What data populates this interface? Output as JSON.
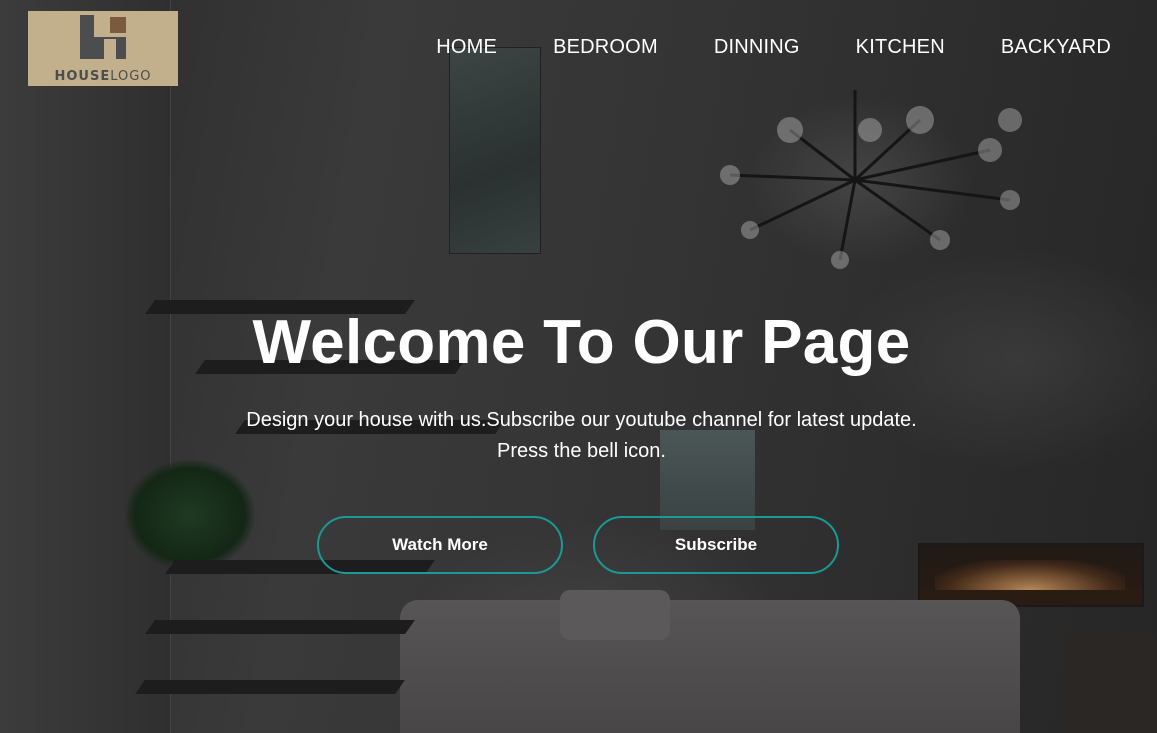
{
  "logo": {
    "text_bold": "HOUSE",
    "text_regular": "LOGO",
    "background_color": "#c2b08d",
    "mark_color": "#4b4d4f",
    "accent_color": "#7a5b3e"
  },
  "nav": {
    "items": [
      {
        "label": "HOME"
      },
      {
        "label": "BEDROOM"
      },
      {
        "label": "DINNING"
      },
      {
        "label": "KITCHEN"
      },
      {
        "label": "BACKYARD"
      }
    ]
  },
  "hero": {
    "title": "Welcome To Our Page",
    "subtitle_line1": "Design your house with us.Subscribe our youtube channel for latest update.",
    "subtitle_line2": "Press the bell icon.",
    "buttons": {
      "watch_more": "Watch More",
      "subscribe": "Subscribe"
    },
    "button_border_color": "#1a9a94",
    "overlay": "dark"
  }
}
